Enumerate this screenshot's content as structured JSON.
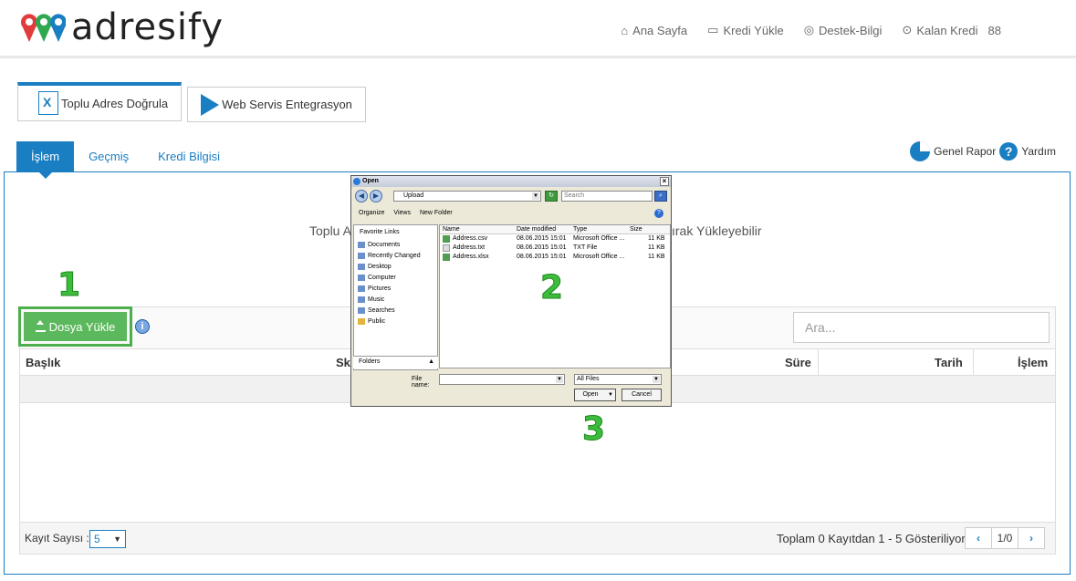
{
  "header": {
    "logo_text": "adresify",
    "nav": [
      {
        "label": "Ana Sayfa"
      },
      {
        "label": "Kredi Yükle"
      },
      {
        "label": "Destek-Bilgi"
      },
      {
        "label": "Kalan Kredi"
      }
    ],
    "credit_value": "88"
  },
  "modules": [
    {
      "label": "Toplu Adres Doğrula"
    },
    {
      "label": "Web Servis Entegrasyon"
    }
  ],
  "subtabs": [
    {
      "label": "İşlem"
    },
    {
      "label": "Geçmiş"
    },
    {
      "label": "Kredi Bilgisi"
    }
  ],
  "tools": {
    "report": "Genel Rapor",
    "help": "Yardım"
  },
  "notice_left": "Toplu A",
  "notice_right": "ırak Yükleyebilir",
  "upload_label": "Dosya Yükle",
  "search_placeholder": "Ara...",
  "table": {
    "columns": [
      "Başlık",
      "Sk",
      "Süre",
      "Tarih",
      "İşlem"
    ]
  },
  "footer": {
    "records_label": "Kayıt Sayısı :",
    "records_value": "5",
    "total_text": "Toplam 0 Kayıtdan 1 - 5 Gösteriliyor.",
    "page": "1/0"
  },
  "steps": [
    "1",
    "2",
    "3"
  ],
  "dialog": {
    "title": "Open",
    "address": "Upload",
    "search_placeholder": "Search",
    "toolbar": [
      "Organize",
      "Views",
      "New Folder"
    ],
    "nav_header": "Favorite Links",
    "nav_items": [
      "Documents",
      "Recently Changed",
      "Desktop",
      "Computer",
      "Pictures",
      "Music",
      "Searches",
      "Public"
    ],
    "folders_label": "Folders",
    "columns": [
      "Name",
      "Date modified",
      "Type",
      "Size"
    ],
    "files": [
      {
        "name": "Address.csv",
        "date": "08.06.2015 15:01",
        "type": "Microsoft Office ...",
        "size": "11 KB"
      },
      {
        "name": "Address.txt",
        "date": "08.06.2015 15:01",
        "type": "TXT File",
        "size": "11 KB"
      },
      {
        "name": "Address.xlsx",
        "date": "08.06.2015 15:01",
        "type": "Microsoft Office ...",
        "size": "11 KB"
      }
    ],
    "filename_label": "File name:",
    "filetype": "All Files",
    "open_label": "Open",
    "cancel_label": "Cancel"
  }
}
